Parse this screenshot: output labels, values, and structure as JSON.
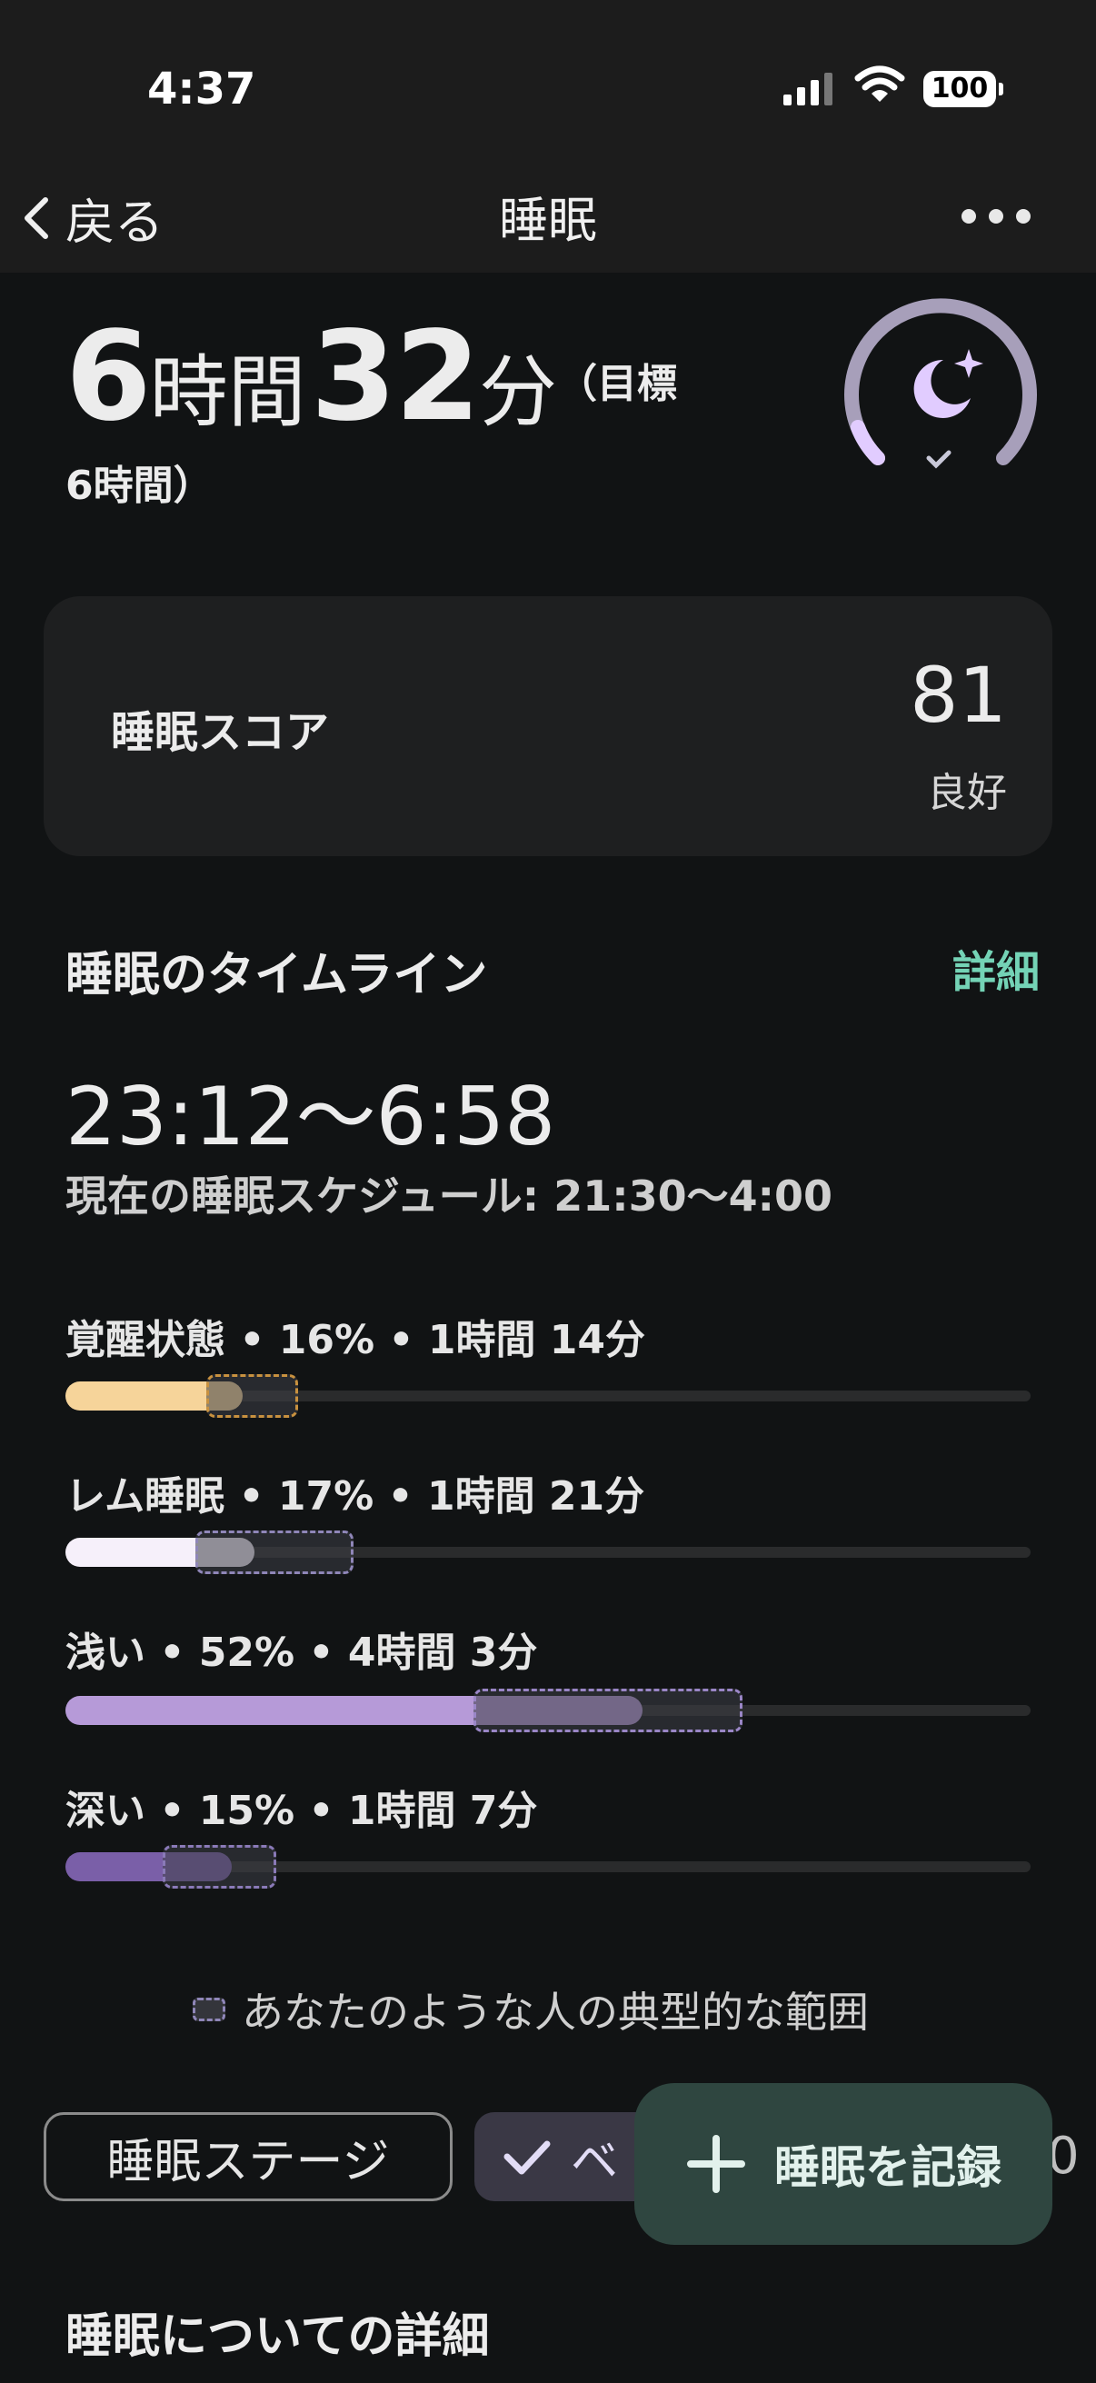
{
  "status_bar": {
    "time": "4:37",
    "battery": "100"
  },
  "nav": {
    "back_label": "戻る",
    "title": "睡眠"
  },
  "summary": {
    "hours": "6",
    "hours_unit": "時間",
    "minutes": "32",
    "minutes_unit": "分",
    "goal_line1": "（目標",
    "goal_line2": "6時間）",
    "goal_ring_progress": 1.0
  },
  "score_card": {
    "label": "睡眠スコア",
    "value": "81",
    "rating": "良好"
  },
  "timeline": {
    "title": "睡眠のタイムライン",
    "details_link": "詳細",
    "range": "23:12〜6:58",
    "schedule": "現在の睡眠スケジュール: 21:30〜4:00"
  },
  "stages": [
    {
      "label": "覚醒状態 • 16% • 1時間 14分",
      "percent": 16,
      "color": "#f6d49a",
      "typical_border": "#c8913f",
      "typical_range": [
        16,
        20
      ]
    },
    {
      "label": "レム睡眠 • 17% • 1時間 21分",
      "percent": 17,
      "color": "#f6f0fa",
      "typical_border": "#8f86b8",
      "typical_range": [
        15,
        25
      ]
    },
    {
      "label": "浅い • 52% • 4時間 3分",
      "percent": 52,
      "color": "#b69ad8",
      "typical_border": "#9a86c6",
      "typical_range": [
        40,
        60
      ]
    },
    {
      "label": "深い • 15% • 1時間 7分",
      "percent": 15,
      "color": "#7a5fa8",
      "typical_border": "#8a7ab8",
      "typical_range": [
        12,
        18
      ]
    }
  ],
  "legend": {
    "text": "あなたのような人の典型的な範囲"
  },
  "chips": {
    "sleep_stages": "睡眠ステージ",
    "selected_partial": "ベ",
    "edge_partial": "0"
  },
  "fab": {
    "label": "睡眠を記録"
  },
  "details_section": {
    "title": "睡眠についての詳細"
  },
  "colors": {
    "accent": "#74d3b6",
    "background": "#111314",
    "card": "#1e1f20",
    "ring": "#a79fba",
    "ring_moon": "#e1ccff"
  }
}
